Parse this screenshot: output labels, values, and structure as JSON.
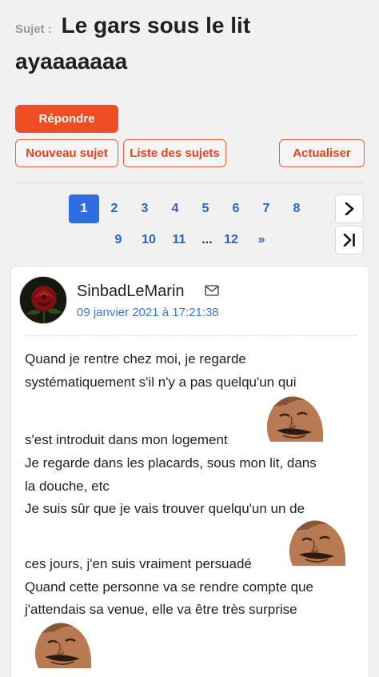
{
  "header": {
    "label": "Sujet :",
    "title_line1": "Le gars sous le lit",
    "title_line2": "ayaaaaaaa"
  },
  "actions": {
    "reply": "Répondre",
    "new_topic": "Nouveau sujet",
    "topic_list": "Liste des sujets",
    "refresh": "Actualiser"
  },
  "pagination": {
    "row1": [
      "1",
      "2",
      "3",
      "4",
      "5",
      "6",
      "7",
      "8"
    ],
    "row2": [
      "9",
      "10",
      "11",
      "...",
      "12",
      "»"
    ],
    "current": "1",
    "next_icon": "chevron-right-icon",
    "last_icon": "last-page-icon"
  },
  "post": {
    "author": "SinbadLeMarin",
    "date": "09 janvier 2021 à 17:21:38",
    "avatar_icon": "rose-avatar",
    "lines": [
      "Quand je rentre chez moi, je regarde",
      "systématiquement s'il n'y a pas quelqu'un qui",
      "s'est introduit dans mon logement",
      "Je regarde dans les placards, sous mon lit, dans",
      "la douche, etc",
      "Je suis sûr que je vais trouver quelqu'un un de",
      "ces jours, j'en suis vraiment persuadé",
      "Quand cette personne va se rendre compte que",
      "j'attendais sa venue, elle va être très surprise"
    ],
    "sticker": "smirking-face-sticker"
  },
  "colors": {
    "accent": "#ef4d23",
    "link": "#2b63c9",
    "active_page": "#2f6ee0",
    "date": "#3f76d4"
  }
}
